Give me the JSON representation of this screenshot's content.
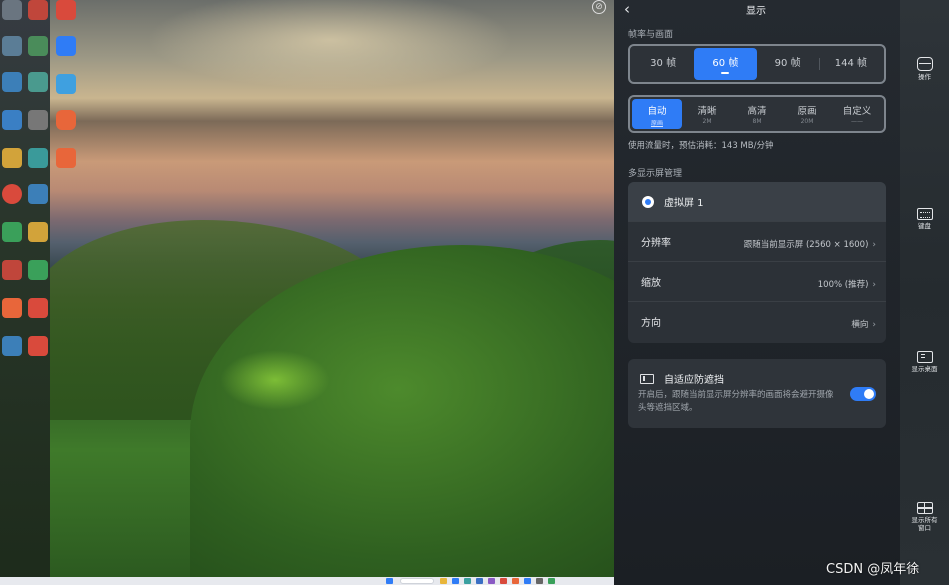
{
  "desktop": {
    "icons": [
      {
        "label": "",
        "color": "#d94a3c"
      },
      {
        "label": "",
        "color": "#2f7cf6"
      },
      {
        "label": "",
        "color": "#3fa0e0"
      },
      {
        "label": "",
        "color": "#e8663a"
      },
      {
        "label": "",
        "color": "#e8663a"
      }
    ]
  },
  "panel": {
    "title": "显示",
    "fps_section_label": "帧率与画面",
    "fps_options": [
      "30 帧",
      "60 帧",
      "90 帧",
      "144 帧"
    ],
    "fps_selected_index": 1,
    "quality_options": [
      {
        "label": "自动",
        "sub": "原画"
      },
      {
        "label": "清晰",
        "sub": "2M"
      },
      {
        "label": "高清",
        "sub": "8M"
      },
      {
        "label": "原画",
        "sub": "20M"
      },
      {
        "label": "自定义",
        "sub": "——"
      }
    ],
    "quality_selected_index": 0,
    "usage_text": "使用流量时，预估消耗：143 MB/分钟",
    "multi_display_label": "多显示屏管理",
    "virtual_screen_label": "虚拟屏 1",
    "rows": [
      {
        "label": "分辨率",
        "value": "跟随当前显示屏 (2560 × 1600)"
      },
      {
        "label": "缩放",
        "value": "100% (推荐)"
      },
      {
        "label": "方向",
        "value": "横向"
      }
    ],
    "adaptive": {
      "title": "自适应防遮挡",
      "desc": "开启后，跟随当前显示屏分辨率的画面将会避开摄像头等遮挡区域。",
      "enabled": true
    }
  },
  "tools": [
    {
      "label": "操作",
      "icon": "gamepad-icon"
    },
    {
      "label": "键盘",
      "icon": "keyboard-icon"
    },
    {
      "label": "显示桌面",
      "icon": "show-desktop-icon"
    },
    {
      "label": "显示所有窗口",
      "icon": "all-windows-icon"
    }
  ],
  "watermark": "CSDN @凤年徐",
  "colors": {
    "accent": "#2f7cf6",
    "panel_bg": "#1f2328"
  }
}
